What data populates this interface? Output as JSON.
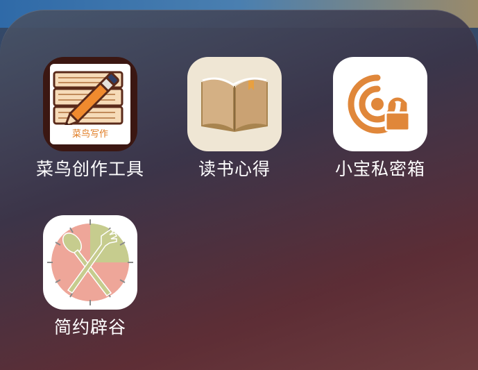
{
  "folder": {
    "apps": [
      {
        "label": "菜鸟创作工具",
        "icon": "pencil-books-icon",
        "icon_text": "菜鸟写作"
      },
      {
        "label": "读书心得",
        "icon": "open-book-icon"
      },
      {
        "label": "小宝私密箱",
        "icon": "signal-lock-icon"
      },
      {
        "label": "简约辟谷",
        "icon": "spoon-fork-clock-icon"
      }
    ]
  },
  "colors": {
    "accent_orange": "#e0873a",
    "book_tan": "#c9a77c",
    "clock_pink": "#eea699",
    "clock_green": "#c6cc8e"
  }
}
